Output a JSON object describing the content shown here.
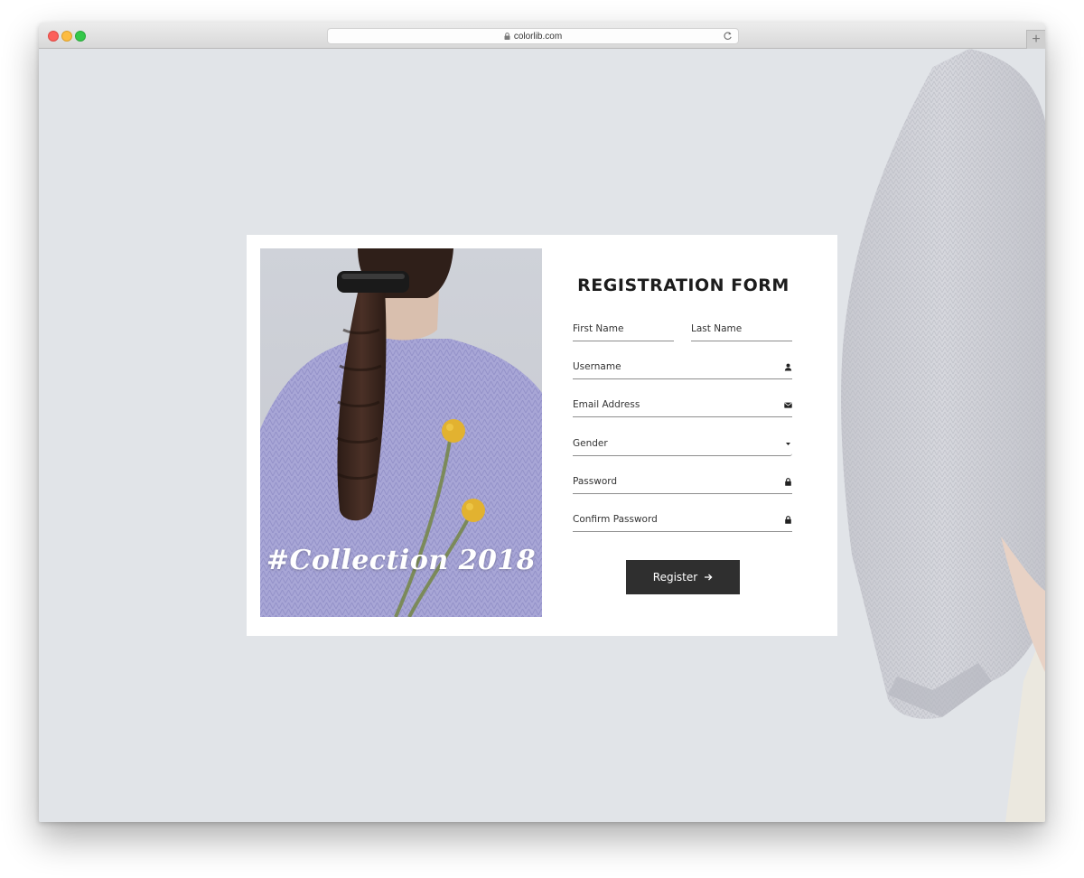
{
  "browser": {
    "url": "colorlib.com",
    "new_tab": "+"
  },
  "photo": {
    "caption": "#Collection 2018"
  },
  "form": {
    "title": "REGISTRATION FORM",
    "first_name": "First Name",
    "last_name": "Last Name",
    "username": "Username",
    "email": "Email Address",
    "gender": "Gender",
    "password": "Password",
    "confirm_password": "Confirm Password",
    "register": "Register"
  },
  "colors": {
    "page_background": "#e1e4e8",
    "button": "#2f2f2f",
    "sweater_lavender": "#a8a6d6"
  },
  "icons": [
    "lock-icon",
    "reload-icon",
    "user-icon",
    "envelope-icon",
    "caret-down-icon",
    "padlock-icon",
    "arrow-right-icon"
  ]
}
